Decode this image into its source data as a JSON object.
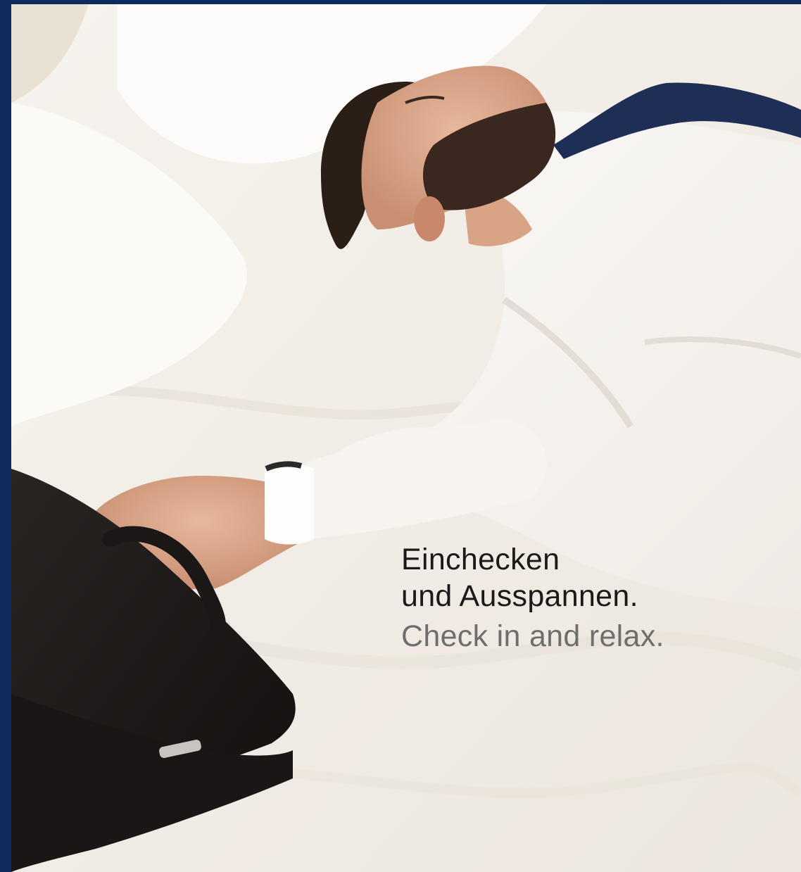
{
  "brand": {
    "accent_color": "#0f2a5c"
  },
  "headline": {
    "line1": "Einchecken",
    "line2": "und Ausspannen.",
    "translation": "Check in and relax."
  }
}
